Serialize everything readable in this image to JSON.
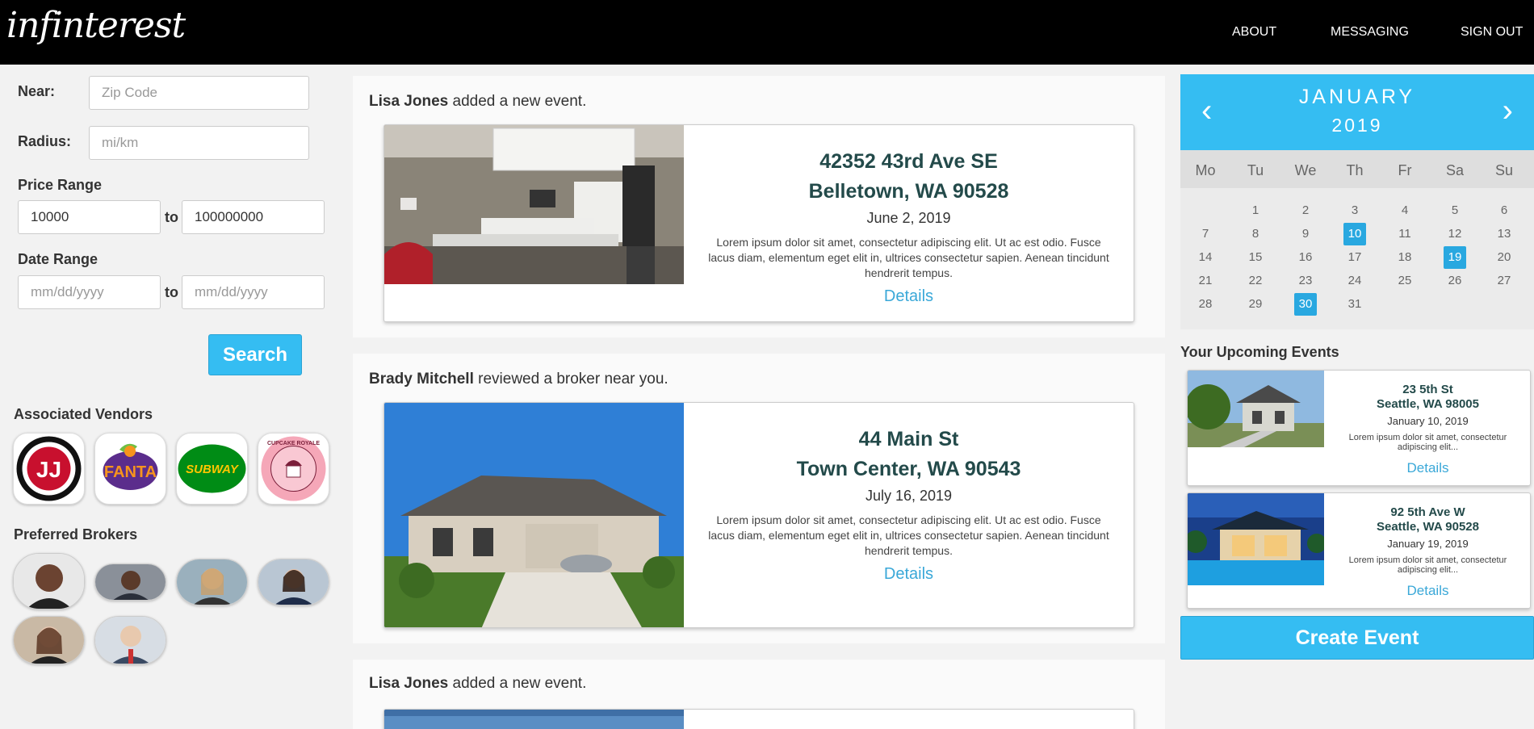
{
  "header": {
    "logo_text": "infinterest",
    "nav": [
      "ABOUT",
      "MESSAGING",
      "SIGN OUT"
    ]
  },
  "filters": {
    "near_label": "Near:",
    "near_placeholder": "Zip Code",
    "radius_label": "Radius:",
    "radius_placeholder": "mi/km",
    "price_label": "Price Range",
    "price_min": "10000",
    "price_max": "100000000",
    "to_label": "to",
    "date_label": "Date Range",
    "date_placeholder": "mm/dd/yyyy",
    "search_label": "Search"
  },
  "vendors": {
    "title": "Associated Vendors",
    "items": [
      {
        "name": "Jimmy John's",
        "icon": "jimmy-johns-logo",
        "text": "JJ"
      },
      {
        "name": "Fanta",
        "icon": "fanta-logo",
        "text": "FANTA"
      },
      {
        "name": "Subway",
        "icon": "subway-logo",
        "text": "SUBWAY"
      },
      {
        "name": "Cupcake Royale",
        "icon": "cupcake-royale-logo",
        "text": "CUPCAKE ROYALE"
      }
    ]
  },
  "brokers": {
    "title": "Preferred Brokers",
    "count": 6
  },
  "feed": [
    {
      "user": "Lisa Jones",
      "action": "added a new event.",
      "address_line1": "42352 43rd Ave SE",
      "address_line2": "Belletown, WA 90528",
      "date": "June 2, 2019",
      "description": "Lorem ipsum dolor sit amet, consectetur adipiscing elit. Ut ac est odio. Fusce lacus diam, elementum eget elit in, ultrices consectetur sapien. Aenean tincidunt hendrerit tempus.",
      "details_label": "Details",
      "photo": "kitchen-photo"
    },
    {
      "user": "Brady Mitchell",
      "action": "reviewed a broker near you.",
      "address_line1": "44 Main St",
      "address_line2": "Town Center, WA 90543",
      "date": "July 16, 2019",
      "description": "Lorem ipsum dolor sit amet, consectetur adipiscing elit. Ut ac est odio. Fusce lacus diam, elementum eget elit in, ultrices consectetur sapien. Aenean tincidunt hendrerit tempus.",
      "details_label": "Details",
      "photo": "house-photo"
    },
    {
      "user": "Lisa Jones",
      "action": "added a new event."
    }
  ],
  "calendar": {
    "month": "JANUARY",
    "year": "2019",
    "prev": "‹",
    "next": "›",
    "weekdays": [
      "Mo",
      "Tu",
      "We",
      "Th",
      "Fr",
      "Sa",
      "Su"
    ],
    "highlighted": [
      10,
      19,
      30
    ],
    "days_in_month": 31
  },
  "upcoming": {
    "title": "Your Upcoming Events",
    "items": [
      {
        "address_line1": "23 5th St",
        "address_line2": "Seattle, WA 98005",
        "date": "January 10, 2019",
        "description": "Lorem ipsum dolor sit amet, consectetur adipiscing elit...",
        "details_label": "Details"
      },
      {
        "address_line1": "92 5th Ave W",
        "address_line2": "Seattle, WA 90528",
        "date": "January 19, 2019",
        "description": "Lorem ipsum dolor sit amet, consectetur adipiscing elit...",
        "details_label": "Details"
      }
    ],
    "create_label": "Create Event"
  },
  "colors": {
    "accent": "#35bdf2",
    "header_bg": "#000000",
    "address_text": "#234a4a",
    "link": "#3aa8d8"
  }
}
